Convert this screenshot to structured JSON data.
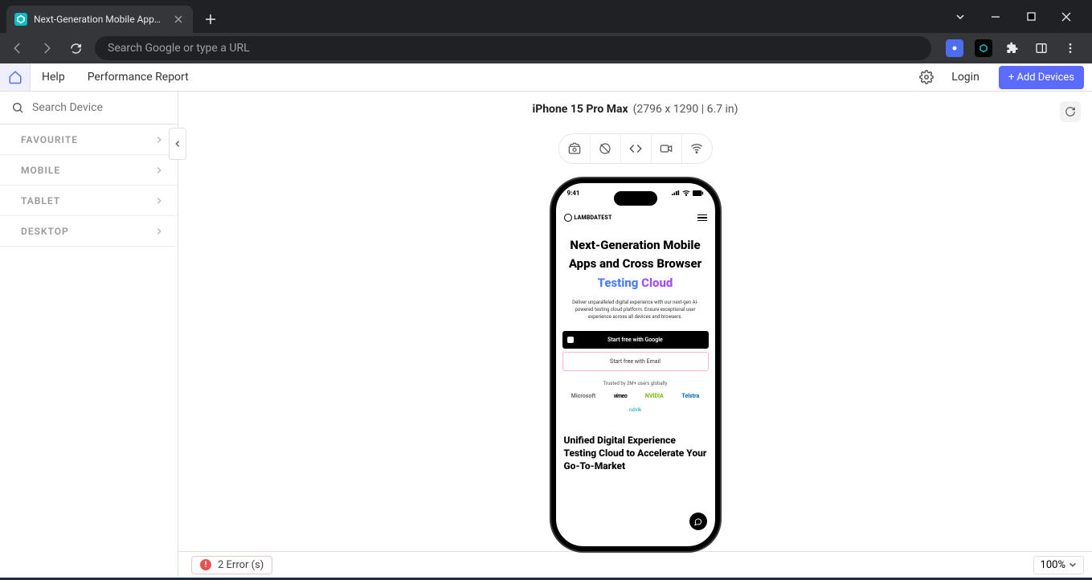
{
  "browser": {
    "tab_title": "Next-Generation Mobile Apps an",
    "omnibox_placeholder": "Search Google or type a URL"
  },
  "header": {
    "help": "Help",
    "perf_report": "Performance Report",
    "login": "Login",
    "add_devices": "+ Add Devices"
  },
  "sidebar": {
    "search_placeholder": "Search Device",
    "groups": [
      "FAVOURITE",
      "MOBILE",
      "TABLET",
      "DESKTOP"
    ]
  },
  "device": {
    "name": "iPhone 15 Pro Max",
    "dims": "(2796 x 1290 | 6.7 in)"
  },
  "phone": {
    "time": "9:41",
    "brand": "LAMBDATEST",
    "hero_line1": "Next-Generation Mobile",
    "hero_line2": "Apps and Cross Browser",
    "hero_line3a": "Testing",
    "hero_line3b": "Cloud",
    "sub": "Deliver unparalleled digital experience with our next-gen AI-powered testing cloud platform. Ensure exceptional user experience across all devices and browsers.",
    "cta_google": "Start free with Google",
    "cta_email": "Start free with Email",
    "trusted": "Trusted by 2M+ users globally",
    "logos": {
      "ms": "Microsoft",
      "vimeo": "vimeo",
      "nvidia": "NVIDIA",
      "telstra": "Telstra",
      "rubrik": "rubrik"
    },
    "unified": "Unified Digital Experience Testing Cloud to Accelerate Your Go-To-Market"
  },
  "footer": {
    "errors": "2 Error (s)",
    "zoom": "100%"
  }
}
